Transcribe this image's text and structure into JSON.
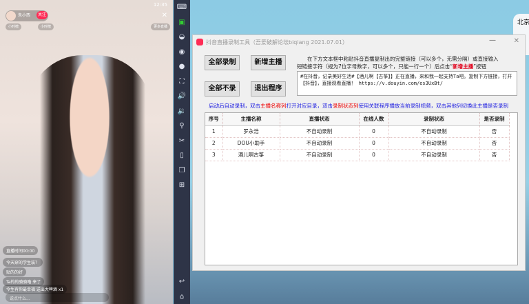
{
  "phone": {
    "time": "12:35",
    "host_name": "朱小西",
    "host_sub": "本场点赞",
    "follow": "关注",
    "chip1": "小时榜",
    "chip2": "小时榜",
    "more": "更多直播",
    "chat": [
      "直播时间00:00",
      "今天穿的学生装？",
      "贴的的好",
      "Ta的的骑骑咯 来了",
      "今生有你最幸福 送出大啤酒 x1"
    ],
    "input_placeholder": "说点什么..."
  },
  "weather": {
    "city": "北京"
  },
  "window": {
    "title": "抖音直播录制工具（吾爱破解论坛biqiang 2021.07.01）",
    "buttons": {
      "record_all": "全部录制",
      "add_host": "新增主播",
      "record_none": "全部不录",
      "exit": "退出程序"
    },
    "desc_line1": "在下方文本框中粘贴抖音直播复制出的完整链接（可以多个，无需分隔）或直接输入",
    "desc_line2a": "短链接字符（规为7位字母数字，可以多个，只能一行一个）后点击“",
    "desc_highlight": "新增主播",
    "desc_line2b": "”按钮",
    "textbox_value": "#在抖音，记录美好生活#【酒儿啊【古筝】】正在直播，来和我一起支持Ta吧。复制下方链接，打开【抖音】，直接观看直播！ https://v.douyin.com/es3UxBt/",
    "hint": [
      "启动后自动录制，双击",
      "主播名称列",
      "打开对应目录，双击",
      "录制状态列",
      "使用关联程序播放当前录制视频，双击其他列切换此主播是否录制"
    ],
    "table": {
      "headers": [
        "序号",
        "主播名称",
        "直播状态",
        "在线人数",
        "录制状态",
        "是否录制"
      ],
      "rows": [
        [
          "1",
          "罗永浩",
          "不自动录制",
          "0",
          "不自动录制",
          "否"
        ],
        [
          "2",
          "DOU小助手",
          "不自动录制",
          "0",
          "不自动录制",
          "否"
        ],
        [
          "3",
          "酒儿啊古筝",
          "不自动录制",
          "0",
          "不自动录制",
          "否"
        ]
      ]
    }
  }
}
